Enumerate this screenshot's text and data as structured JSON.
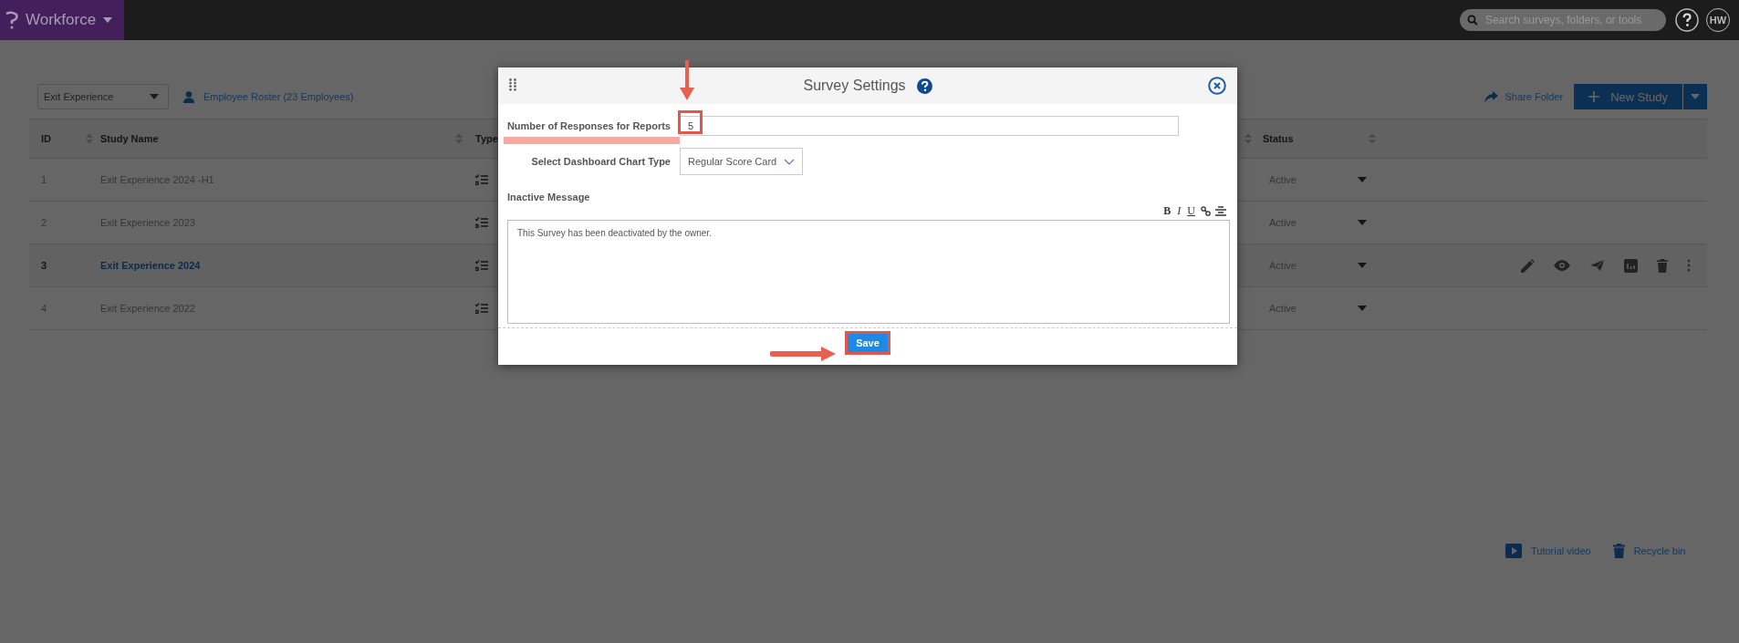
{
  "app": {
    "name": "Workforce"
  },
  "search": {
    "placeholder": "Search surveys, folders, or tools"
  },
  "user": {
    "initials": "HW"
  },
  "folder_select": {
    "value": "Exit Experience"
  },
  "roster_link": "Employee Roster (23 Employees)",
  "share_folder": "Share Folder",
  "new_study": "New Study",
  "table": {
    "columns": [
      {
        "label": "ID"
      },
      {
        "label": "Study Name"
      },
      {
        "label": "Type"
      },
      {
        "label": "Status"
      }
    ],
    "rows": [
      {
        "id": "1",
        "name": "Exit Experience 2024 -H1",
        "status": "Active",
        "selected": false
      },
      {
        "id": "2",
        "name": "Exit Experience 2023",
        "status": "Active",
        "selected": false
      },
      {
        "id": "3",
        "name": "Exit Experience 2024",
        "status": "Active",
        "selected": true
      },
      {
        "id": "4",
        "name": "Exit Experience 2022",
        "status": "Active",
        "selected": false
      }
    ]
  },
  "modal": {
    "title": "Survey Settings",
    "fields": [
      {
        "kind": "text",
        "label": "Number of Responses for Reports",
        "value": "5"
      },
      {
        "kind": "select",
        "label": "Select Dashboard Chart Type",
        "value": "Regular Score Card"
      }
    ],
    "message_label": "Inactive Message",
    "format_buttons": [
      {
        "kind": "bold",
        "label": "B"
      },
      {
        "kind": "italic",
        "label": "I"
      },
      {
        "kind": "underline",
        "label": "U"
      }
    ],
    "message": "This Survey has been deactivated by the owner.",
    "save": "Save"
  },
  "footer_links": [
    {
      "kind": "video",
      "label": "Tutorial video"
    },
    {
      "kind": "trash",
      "label": "Recycle bin"
    }
  ]
}
